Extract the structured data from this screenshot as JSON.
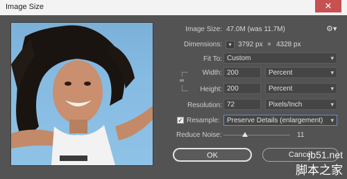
{
  "window": {
    "title": "Image Size",
    "close_glyph": "✕"
  },
  "image_size": {
    "label": "Image Size:",
    "value": "47.0M (was 11.7M)",
    "settings_icon": "gear-icon"
  },
  "dimensions": {
    "label": "Dimensions:",
    "width_px": "3792 px",
    "times": "×",
    "height_px": "4328 px",
    "dropdown_icon": "chevron-down-icon"
  },
  "fit_to": {
    "label": "Fit To:",
    "value": "Custom"
  },
  "width": {
    "label": "Width:",
    "value": "200",
    "unit": "Percent"
  },
  "height": {
    "label": "Height:",
    "value": "200",
    "unit": "Percent"
  },
  "constrain": {
    "icon": "link-icon"
  },
  "resolution": {
    "label": "Resolution:",
    "value": "72",
    "unit": "Pixels/Inch"
  },
  "resample": {
    "label": "Resample:",
    "checked": true,
    "value": "Preserve Details (enlargement)"
  },
  "reduce_noise": {
    "label": "Reduce Noise:",
    "value": "11",
    "level_fraction": 0.11
  },
  "buttons": {
    "ok": "OK",
    "cancel": "Cancel"
  },
  "watermark": {
    "site": "jb51.net",
    "cn": "脚本之家"
  },
  "colors": {
    "dialog_bg": "#535353",
    "field_bg": "#454545",
    "titlebar_bg": "#f3f3f3",
    "close_bg": "#c75050"
  }
}
